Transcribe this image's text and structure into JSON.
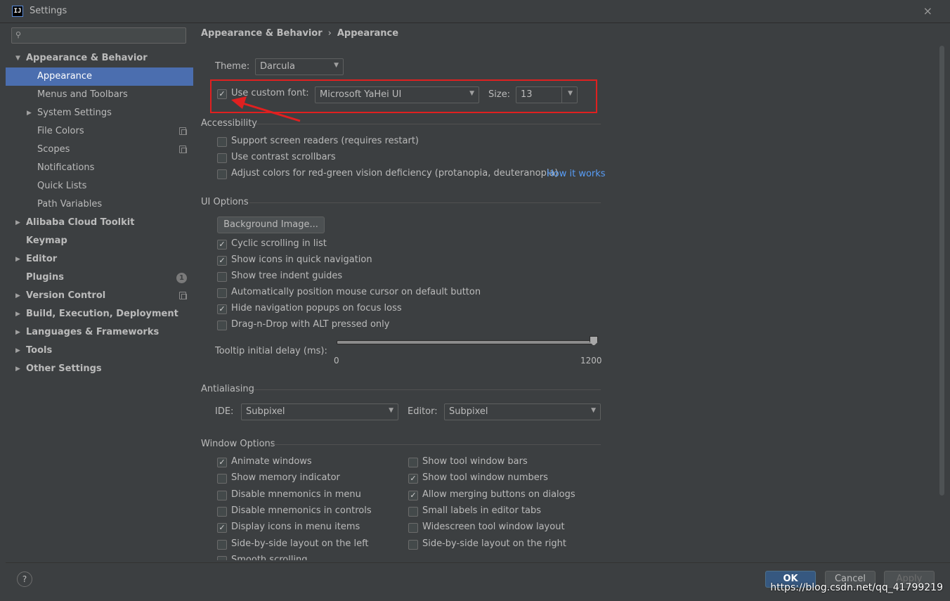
{
  "window": {
    "title": "Settings",
    "icon_label": "IJ",
    "close": "×"
  },
  "sidebar": {
    "search_placeholder": "",
    "items": [
      {
        "label": "Appearance & Behavior",
        "arrow": "▼",
        "bold": true
      },
      {
        "label": "Appearance",
        "selected": true
      },
      {
        "label": "Menus and Toolbars"
      },
      {
        "label": "System Settings",
        "arrow": "▶"
      },
      {
        "label": "File Colors"
      },
      {
        "label": "Scopes"
      },
      {
        "label": "Notifications"
      },
      {
        "label": "Quick Lists"
      },
      {
        "label": "Path Variables"
      },
      {
        "label": "Alibaba Cloud Toolkit",
        "arrow": "▶",
        "bold": true
      },
      {
        "label": "Keymap",
        "bold": true
      },
      {
        "label": "Editor",
        "arrow": "▶",
        "bold": true
      },
      {
        "label": "Plugins",
        "bold": true,
        "badge": "1"
      },
      {
        "label": "Version Control",
        "arrow": "▶",
        "bold": true
      },
      {
        "label": "Build, Execution, Deployment",
        "arrow": "▶",
        "bold": true
      },
      {
        "label": "Languages & Frameworks",
        "arrow": "▶",
        "bold": true
      },
      {
        "label": "Tools",
        "arrow": "▶",
        "bold": true
      },
      {
        "label": "Other Settings",
        "arrow": "▶",
        "bold": true
      }
    ]
  },
  "breadcrumb": {
    "parent": "Appearance & Behavior",
    "sep": "›",
    "current": "Appearance"
  },
  "theme": {
    "label": "Theme:",
    "value": "Darcula"
  },
  "custom_font": {
    "checked": true,
    "label": "Use custom font:",
    "font": "Microsoft YaHei UI",
    "size_label": "Size:",
    "size": "13"
  },
  "accessibility": {
    "title": "Accessibility",
    "items": [
      {
        "label": "Support screen readers (requires restart)",
        "checked": false
      },
      {
        "label": "Use contrast scrollbars",
        "checked": false
      },
      {
        "label": "Adjust colors for red-green vision deficiency (protanopia, deuteranopia)",
        "checked": false
      }
    ],
    "link": "How it works"
  },
  "ui_options": {
    "title": "UI Options",
    "bg_button": "Background Image...",
    "items": [
      {
        "label": "Cyclic scrolling in list",
        "checked": true
      },
      {
        "label": "Show icons in quick navigation",
        "checked": true
      },
      {
        "label": "Show tree indent guides",
        "checked": false
      },
      {
        "label": "Automatically position mouse cursor on default button",
        "checked": false
      },
      {
        "label": "Hide navigation popups on focus loss",
        "checked": true
      },
      {
        "label": "Drag-n-Drop with ALT pressed only",
        "checked": false
      }
    ],
    "tooltip_label": "Tooltip initial delay (ms):",
    "tooltip_min": "0",
    "tooltip_max": "1200",
    "tooltip_value": 1200
  },
  "antialiasing": {
    "title": "Antialiasing",
    "ide_label": "IDE:",
    "ide_value": "Subpixel",
    "editor_label": "Editor:",
    "editor_value": "Subpixel"
  },
  "window_options": {
    "title": "Window Options",
    "left": [
      {
        "label": "Animate windows",
        "checked": true
      },
      {
        "label": "Show memory indicator",
        "checked": false
      },
      {
        "label": "Disable mnemonics in menu",
        "checked": false
      },
      {
        "label": "Disable mnemonics in controls",
        "checked": false
      },
      {
        "label": "Display icons in menu items",
        "checked": true
      },
      {
        "label": "Side-by-side layout on the left",
        "checked": false
      },
      {
        "label": "Smooth scrolling",
        "checked": false
      }
    ],
    "right": [
      {
        "label": "Show tool window bars",
        "checked": false
      },
      {
        "label": "Show tool window numbers",
        "checked": true
      },
      {
        "label": "Allow merging buttons on dialogs",
        "checked": true
      },
      {
        "label": "Small labels in editor tabs",
        "checked": false
      },
      {
        "label": "Widescreen tool window layout",
        "checked": false
      },
      {
        "label": "Side-by-side layout on the right",
        "checked": false
      }
    ]
  },
  "footer": {
    "help": "?",
    "ok": "OK",
    "cancel": "Cancel",
    "apply": "Apply"
  },
  "watermark": "https://blog.csdn.net/qq_41799219",
  "colors": {
    "accent": "#4b6eaf",
    "annotation": "#e02020",
    "link": "#589df6"
  }
}
